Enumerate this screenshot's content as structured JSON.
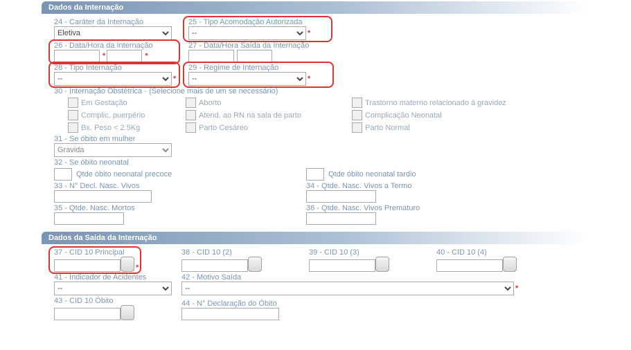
{
  "section1_title": "Dados da Internação",
  "section2_title": "Dados da Saida da Internação",
  "f24": {
    "label": "24 - Caráter da Internação",
    "value": "Eletiva"
  },
  "f25": {
    "label": "25 - Tipo Acomodação Autorizada",
    "value": "--",
    "req": "*"
  },
  "f26": {
    "label": "26 - Data/Hora da Internação",
    "v1": "",
    "v2": "",
    "req": "*"
  },
  "f27": {
    "label": "27 - Data/Hora Saída da Internação",
    "v1": "",
    "v2": ""
  },
  "f28": {
    "label": "28 - Tipo Internação",
    "value": "--",
    "req": "*"
  },
  "f29": {
    "label": "29 - Regime de Internação",
    "value": "--",
    "req": "*"
  },
  "f30": {
    "label": "30 - Internação Obstétrica - (Selecione mais de um se necessário)"
  },
  "obst": {
    "r1c1": "Em Gestação",
    "r1c2": "Aborto",
    "r1c3": "Trastorno materno relacionado à gravidez",
    "r2c1": "Complic. puerpério",
    "r2c2": "Atend. ao RN na sala de parto",
    "r2c3": "Complicação Neonatal",
    "r3c1": "Bx. Peso < 2.5Kg",
    "r3c2": "Parto Cesáreo",
    "r3c3": "Parto Normal"
  },
  "f31": {
    "label": "31 - Se óbito em mulher",
    "value": "Gravida"
  },
  "f32": {
    "label": "32 - Se óbito neonatal",
    "c1": "Qtde óbito neonatal precoce",
    "c2": "Qtde óbito neonatal tardio"
  },
  "f33": {
    "label": "33 - N° Decl. Nasc. Vivos"
  },
  "f34": {
    "label": "34 - Qtde. Nasc. Vivos a Termo"
  },
  "f35": {
    "label": "35 - Qtde. Nasc. Mortos"
  },
  "f36": {
    "label": "36 - Qtde. Nasc. Vivos Prematuro"
  },
  "f37": {
    "label": "37 - CID 10 Principal",
    "req": "*"
  },
  "f38": {
    "label": "38 - CID 10 (2)"
  },
  "f39": {
    "label": "39 - CID 10 (3)"
  },
  "f40": {
    "label": "40 - CID 10 (4)"
  },
  "f41": {
    "label": "41 - Indicador de Acidentes",
    "value": "--"
  },
  "f42": {
    "label": "42 - Motivo Saída",
    "value": "--",
    "req": "*"
  },
  "f43": {
    "label": "43 - CID 10 Óbito"
  },
  "f44": {
    "label": "44 - N° Declaração do Óbito"
  }
}
